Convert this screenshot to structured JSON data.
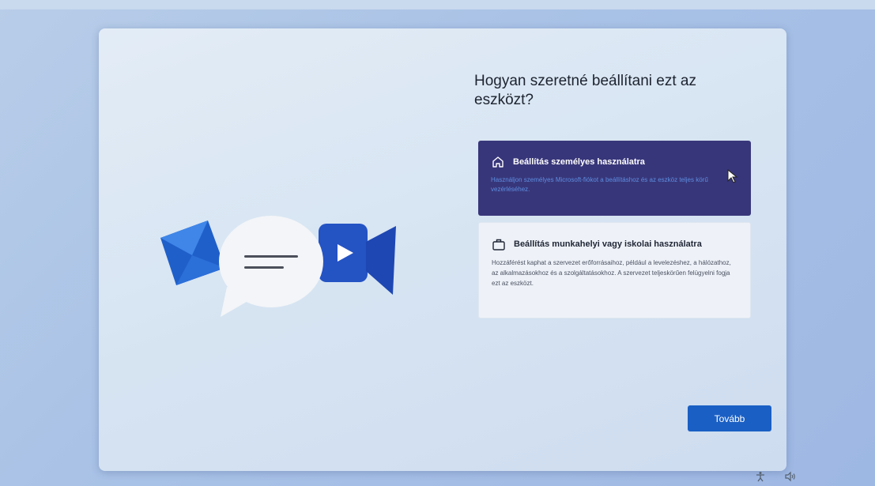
{
  "page": {
    "title": "Hogyan szeretné beállítani ezt az eszközt?"
  },
  "options": [
    {
      "id": "personal",
      "icon": "home-icon",
      "title": "Beállítás személyes használatra",
      "description": "Használjon személyes Microsoft-fiókot a beállításhoz és az eszköz teljes körű vezérléséhez.",
      "selected": true
    },
    {
      "id": "work",
      "icon": "briefcase-icon",
      "title": "Beállítás munkahelyi vagy iskolai használatra",
      "description": "Hozzáférést kaphat a szervezet erőforrásaihoz, például a levelezéshez, a hálózathoz, az alkalmazásokhoz és a szolgáltatásokhoz. A szervezet teljeskörűen felügyelni fogja ezt az eszközt.",
      "selected": false
    }
  ],
  "buttons": {
    "next_label": "Tovább"
  },
  "tray": {
    "icons": [
      "accessibility-icon",
      "volume-icon"
    ]
  },
  "colors": {
    "accent": "#1a5fc4",
    "selected_option": "#38367a"
  }
}
